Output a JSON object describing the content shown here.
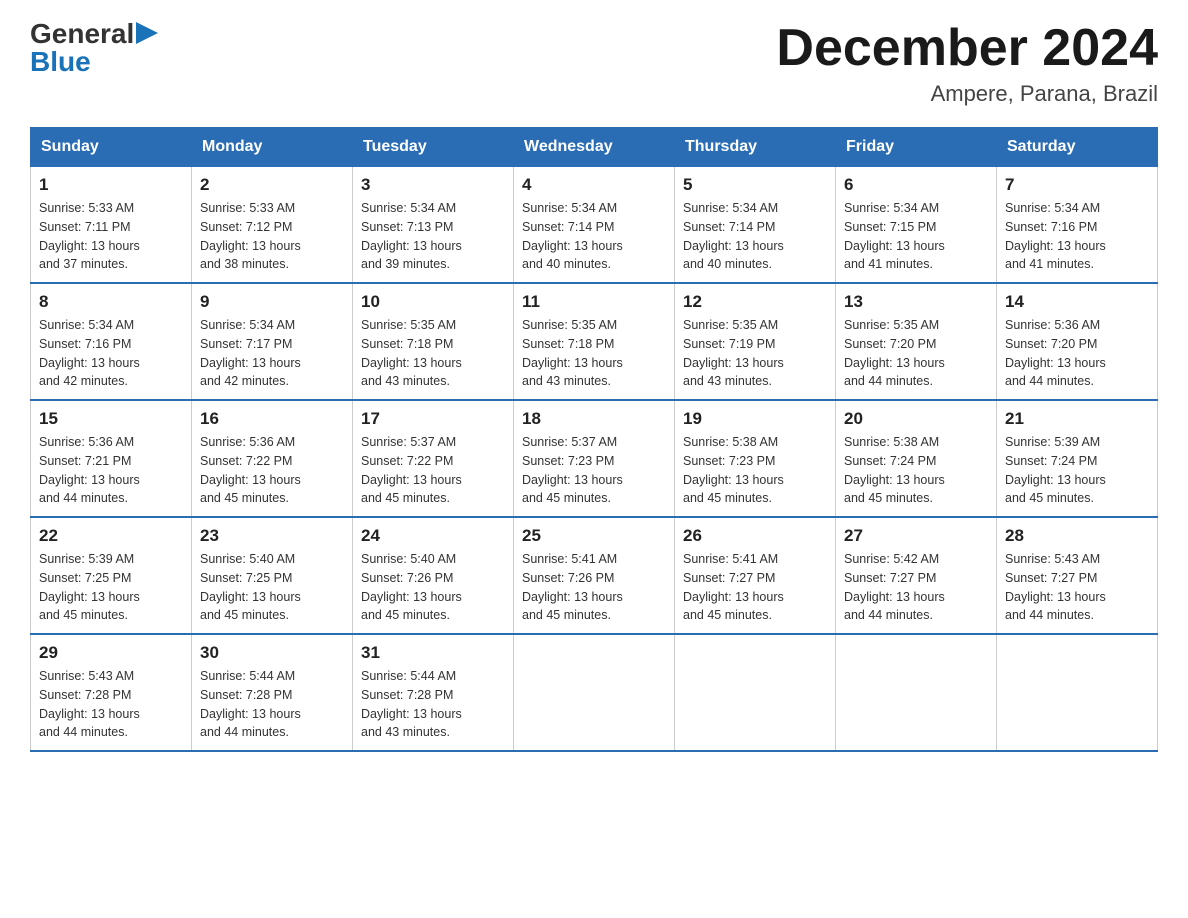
{
  "logo": {
    "general": "General",
    "blue": "Blue"
  },
  "title": "December 2024",
  "subtitle": "Ampere, Parana, Brazil",
  "headers": [
    "Sunday",
    "Monday",
    "Tuesday",
    "Wednesday",
    "Thursday",
    "Friday",
    "Saturday"
  ],
  "weeks": [
    [
      {
        "day": "1",
        "sunrise": "5:33 AM",
        "sunset": "7:11 PM",
        "daylight": "13 hours and 37 minutes."
      },
      {
        "day": "2",
        "sunrise": "5:33 AM",
        "sunset": "7:12 PM",
        "daylight": "13 hours and 38 minutes."
      },
      {
        "day": "3",
        "sunrise": "5:34 AM",
        "sunset": "7:13 PM",
        "daylight": "13 hours and 39 minutes."
      },
      {
        "day": "4",
        "sunrise": "5:34 AM",
        "sunset": "7:14 PM",
        "daylight": "13 hours and 40 minutes."
      },
      {
        "day": "5",
        "sunrise": "5:34 AM",
        "sunset": "7:14 PM",
        "daylight": "13 hours and 40 minutes."
      },
      {
        "day": "6",
        "sunrise": "5:34 AM",
        "sunset": "7:15 PM",
        "daylight": "13 hours and 41 minutes."
      },
      {
        "day": "7",
        "sunrise": "5:34 AM",
        "sunset": "7:16 PM",
        "daylight": "13 hours and 41 minutes."
      }
    ],
    [
      {
        "day": "8",
        "sunrise": "5:34 AM",
        "sunset": "7:16 PM",
        "daylight": "13 hours and 42 minutes."
      },
      {
        "day": "9",
        "sunrise": "5:34 AM",
        "sunset": "7:17 PM",
        "daylight": "13 hours and 42 minutes."
      },
      {
        "day": "10",
        "sunrise": "5:35 AM",
        "sunset": "7:18 PM",
        "daylight": "13 hours and 43 minutes."
      },
      {
        "day": "11",
        "sunrise": "5:35 AM",
        "sunset": "7:18 PM",
        "daylight": "13 hours and 43 minutes."
      },
      {
        "day": "12",
        "sunrise": "5:35 AM",
        "sunset": "7:19 PM",
        "daylight": "13 hours and 43 minutes."
      },
      {
        "day": "13",
        "sunrise": "5:35 AM",
        "sunset": "7:20 PM",
        "daylight": "13 hours and 44 minutes."
      },
      {
        "day": "14",
        "sunrise": "5:36 AM",
        "sunset": "7:20 PM",
        "daylight": "13 hours and 44 minutes."
      }
    ],
    [
      {
        "day": "15",
        "sunrise": "5:36 AM",
        "sunset": "7:21 PM",
        "daylight": "13 hours and 44 minutes."
      },
      {
        "day": "16",
        "sunrise": "5:36 AM",
        "sunset": "7:22 PM",
        "daylight": "13 hours and 45 minutes."
      },
      {
        "day": "17",
        "sunrise": "5:37 AM",
        "sunset": "7:22 PM",
        "daylight": "13 hours and 45 minutes."
      },
      {
        "day": "18",
        "sunrise": "5:37 AM",
        "sunset": "7:23 PM",
        "daylight": "13 hours and 45 minutes."
      },
      {
        "day": "19",
        "sunrise": "5:38 AM",
        "sunset": "7:23 PM",
        "daylight": "13 hours and 45 minutes."
      },
      {
        "day": "20",
        "sunrise": "5:38 AM",
        "sunset": "7:24 PM",
        "daylight": "13 hours and 45 minutes."
      },
      {
        "day": "21",
        "sunrise": "5:39 AM",
        "sunset": "7:24 PM",
        "daylight": "13 hours and 45 minutes."
      }
    ],
    [
      {
        "day": "22",
        "sunrise": "5:39 AM",
        "sunset": "7:25 PM",
        "daylight": "13 hours and 45 minutes."
      },
      {
        "day": "23",
        "sunrise": "5:40 AM",
        "sunset": "7:25 PM",
        "daylight": "13 hours and 45 minutes."
      },
      {
        "day": "24",
        "sunrise": "5:40 AM",
        "sunset": "7:26 PM",
        "daylight": "13 hours and 45 minutes."
      },
      {
        "day": "25",
        "sunrise": "5:41 AM",
        "sunset": "7:26 PM",
        "daylight": "13 hours and 45 minutes."
      },
      {
        "day": "26",
        "sunrise": "5:41 AM",
        "sunset": "7:27 PM",
        "daylight": "13 hours and 45 minutes."
      },
      {
        "day": "27",
        "sunrise": "5:42 AM",
        "sunset": "7:27 PM",
        "daylight": "13 hours and 44 minutes."
      },
      {
        "day": "28",
        "sunrise": "5:43 AM",
        "sunset": "7:27 PM",
        "daylight": "13 hours and 44 minutes."
      }
    ],
    [
      {
        "day": "29",
        "sunrise": "5:43 AM",
        "sunset": "7:28 PM",
        "daylight": "13 hours and 44 minutes."
      },
      {
        "day": "30",
        "sunrise": "5:44 AM",
        "sunset": "7:28 PM",
        "daylight": "13 hours and 44 minutes."
      },
      {
        "day": "31",
        "sunrise": "5:44 AM",
        "sunset": "7:28 PM",
        "daylight": "13 hours and 43 minutes."
      },
      null,
      null,
      null,
      null
    ]
  ],
  "labels": {
    "sunrise": "Sunrise:",
    "sunset": "Sunset:",
    "daylight": "Daylight:"
  }
}
